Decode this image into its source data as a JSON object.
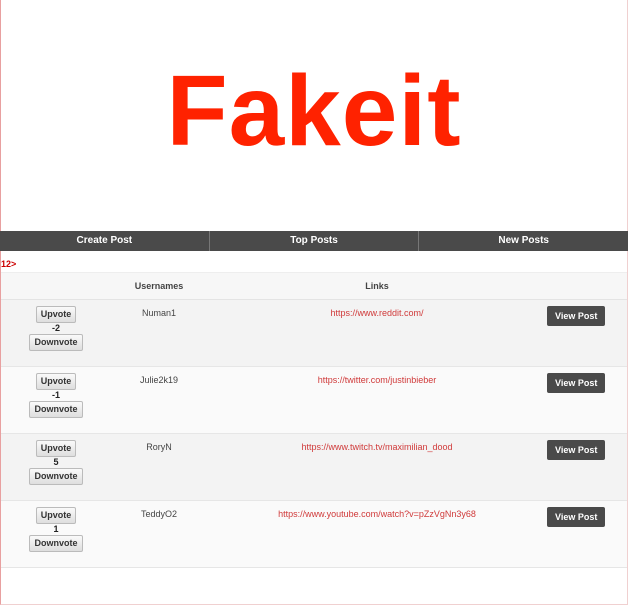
{
  "title": "Fakeit",
  "nav": [
    "Create Post",
    "Top Posts",
    "New Posts"
  ],
  "crumb": "12>",
  "headers": {
    "usernames": "Usernames",
    "links": "Links"
  },
  "upvote_label": "Upvote",
  "downvote_label": "Downvote",
  "view_label": "View Post",
  "posts": [
    {
      "user": "Numan1",
      "link": "https://www.reddit.com/",
      "score": "-2"
    },
    {
      "user": "Julie2k19",
      "link": "https://twitter.com/justinbieber",
      "score": "-1"
    },
    {
      "user": "RoryN",
      "link": "https://www.twitch.tv/maximilian_dood",
      "score": "5"
    },
    {
      "user": "TeddyO2",
      "link": "https://www.youtube.com/watch?v=pZzVgNn3y68",
      "score": "1"
    }
  ]
}
